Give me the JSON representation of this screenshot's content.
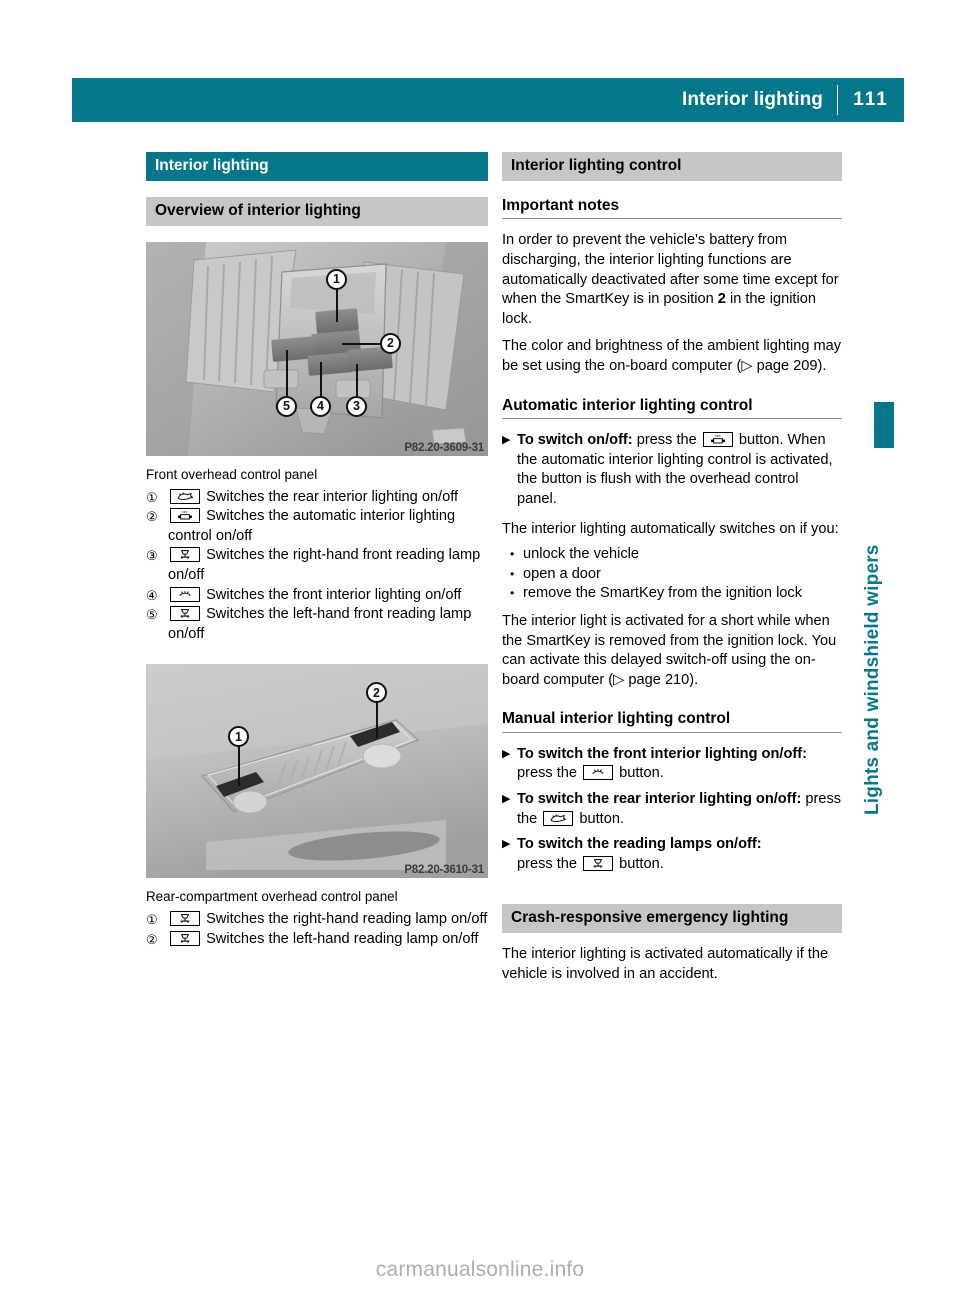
{
  "header": {
    "title": "Interior lighting",
    "page_number": "111"
  },
  "side_tab": {
    "label": "Lights and windshield wipers"
  },
  "left_column": {
    "banner_teal": "Interior lighting",
    "banner_gray": "Overview of interior lighting",
    "figure1": {
      "code": "P82.20-3609-31",
      "callouts": [
        "1",
        "2",
        "3",
        "4",
        "5"
      ]
    },
    "caption1": "Front overhead control panel",
    "items1": [
      {
        "marker": "①",
        "icon": "rear-interior-lamp-icon",
        "text": "Switches the rear interior lighting on/off"
      },
      {
        "marker": "②",
        "icon": "automatic-lighting-control-off-icon",
        "text": "Switches the automatic interior lighting control on/off"
      },
      {
        "marker": "③",
        "icon": "reading-lamp-icon",
        "text": "Switches the right-hand front reading lamp on/off"
      },
      {
        "marker": "④",
        "icon": "front-interior-lamp-icon",
        "text": "Switches the front interior lighting on/off"
      },
      {
        "marker": "⑤",
        "icon": "reading-lamp-icon",
        "text": "Switches the left-hand front reading lamp on/off"
      }
    ],
    "figure2": {
      "code": "P82.20-3610-31",
      "callouts": [
        "1",
        "2"
      ]
    },
    "caption2": "Rear-compartment overhead control panel",
    "items2": [
      {
        "marker": "①",
        "icon": "reading-lamp-icon",
        "text": "Switches the right-hand reading lamp on/off"
      },
      {
        "marker": "②",
        "icon": "reading-lamp-icon",
        "text": "Switches the left-hand reading lamp on/off"
      }
    ]
  },
  "right_column": {
    "banner_gray_top": "Interior lighting control",
    "heading_important": "Important notes",
    "para_important_1_a": "In order to prevent the vehicle's battery from discharging, the interior lighting functions are automatically deactivated after some time except for when the SmartKey is in position ",
    "para_important_1_bold": "2",
    "para_important_1_b": " in the ignition lock.",
    "para_important_2_a": "The color and brightness of the ambient lighting may be set using the on-board computer (",
    "para_important_2_ref": "▷ page 209",
    "para_important_2_b": ").",
    "heading_automatic": "Automatic interior lighting control",
    "step_auto_bold": "To switch on/off:",
    "step_auto_text_a": " press the ",
    "step_auto_text_b": " button. When the automatic interior lighting control is activated, the button is flush with the overhead control panel.",
    "para_auto_switches": "The interior lighting automatically switches on if you:",
    "bullets_auto": [
      "unlock the vehicle",
      "open a door",
      "remove the SmartKey from the ignition lock"
    ],
    "para_auto_delay_a": "The interior light is activated for a short while when the SmartKey is removed from the ignition lock. You can activate this delayed switch-off using the on-board computer (",
    "para_auto_delay_ref": "▷ page 210",
    "para_auto_delay_b": ").",
    "heading_manual": "Manual interior lighting control",
    "steps_manual": [
      {
        "bold": "To switch the front interior lighting on/off:",
        "text_a": " press the ",
        "icon": "front-interior-lamp-icon",
        "text_b": " button."
      },
      {
        "bold": "To switch the rear interior lighting on/off:",
        "text_a": " press the ",
        "icon": "rear-interior-lamp-icon",
        "text_b": " button."
      },
      {
        "bold": "To switch the reading lamps on/off:",
        "text_a": " press the ",
        "icon": "reading-lamp-icon",
        "text_b": " button."
      }
    ],
    "banner_gray_crash": "Crash-responsive emergency lighting",
    "para_crash": "The interior lighting is activated automatically if the vehicle is involved in an accident."
  },
  "footer": {
    "watermark": "carmanualsonline.info"
  },
  "colors": {
    "teal": "#04778a",
    "banner_gray": "#c6c6c6",
    "rule_gray": "#8f8f8f",
    "watermark_gray": "#aeaeae"
  }
}
